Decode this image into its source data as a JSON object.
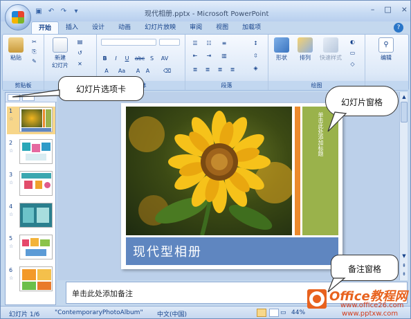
{
  "window": {
    "title": "现代相册.pptx - Microsoft PowerPoint",
    "controls": [
      "–",
      "□",
      "×"
    ]
  },
  "quick_access": {
    "icons": [
      "save-icon",
      "undo-icon",
      "redo-icon",
      "customize-icon"
    ]
  },
  "ribbon": {
    "tabs": [
      "开始",
      "插入",
      "设计",
      "动画",
      "幻灯片放映",
      "审阅",
      "视图",
      "加载项"
    ],
    "active_tab": "开始",
    "groups": {
      "clipboard": {
        "label": "剪贴板",
        "paste": "粘贴"
      },
      "slides": {
        "new_slide_line1": "新建",
        "new_slide_line2": "幻灯片"
      },
      "font": {
        "label": "字体",
        "buttons": [
          "B",
          "I",
          "U",
          "abc",
          "S",
          "AV"
        ]
      },
      "paragraph": {
        "label": "段落"
      },
      "drawing": {
        "label": "绘图",
        "shape": "形状",
        "arrange": "排列",
        "quick_style": "快速样式"
      },
      "editing": {
        "label": "编辑"
      }
    }
  },
  "slides_panel": {
    "slides": [
      {
        "num": "1",
        "star": "☆"
      },
      {
        "num": "2",
        "star": "☆"
      },
      {
        "num": "3",
        "star": "☆"
      },
      {
        "num": "4",
        "star": "☆"
      },
      {
        "num": "5",
        "star": "☆"
      },
      {
        "num": "6",
        "star": "☆"
      }
    ]
  },
  "slide": {
    "caption": "现代型相册",
    "vertical_text": "单击此处添加标题"
  },
  "notes": {
    "placeholder": "单击此处添加备注"
  },
  "status": {
    "slide": "幻灯片 1/6",
    "theme": "\"ContemporaryPhotoAlbum\"",
    "language": "中文(中国)",
    "zoom": "44%"
  },
  "callouts": {
    "slide_tab": "幻灯片选项卡",
    "slide_pane": "幻灯片窗格",
    "notes_pane": "备注窗格"
  },
  "watermark": {
    "brand": "Office教程网",
    "url1": "www.office26.com",
    "url2": "www.pptxw.com"
  }
}
